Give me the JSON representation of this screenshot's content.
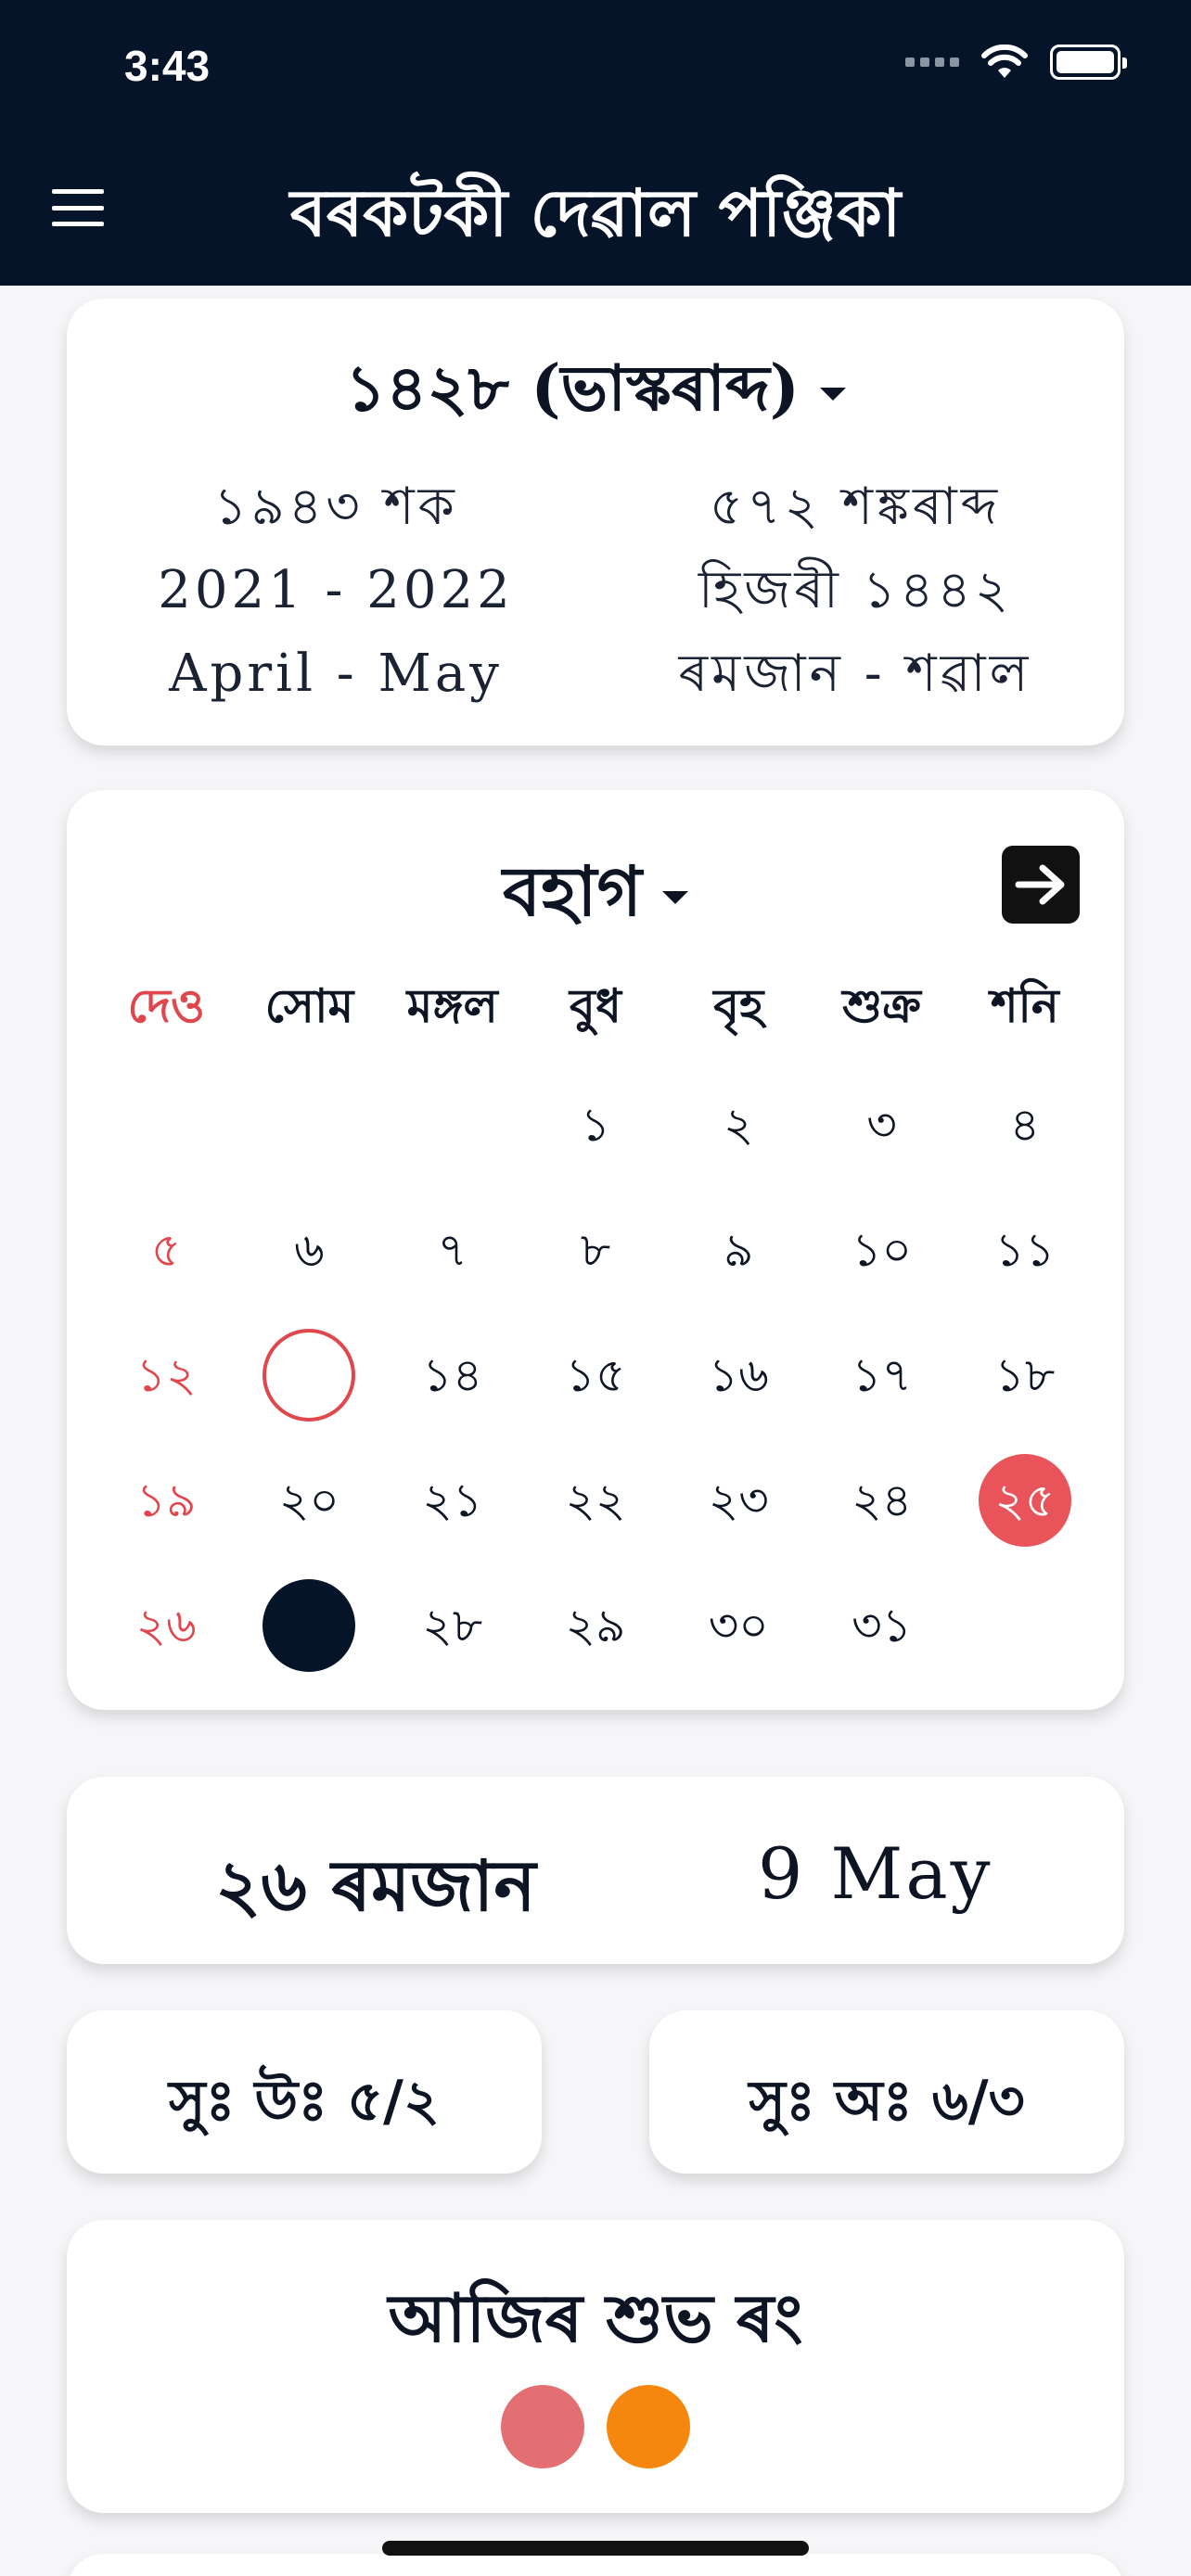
{
  "status": {
    "time": "3:43",
    "signal_icon": "signal-dots-icon",
    "wifi_icon": "wifi-icon",
    "battery_icon": "battery-icon"
  },
  "header": {
    "title": "বৰকটকী দেৱাল পঞ্জিকা",
    "menu_icon": "hamburger-menu-icon"
  },
  "year": {
    "title": "১৪২৮ (ভাস্কৰাব্দ)",
    "left": [
      "১৯৪৩ শক",
      "2021 - 2022",
      "April - May"
    ],
    "right": [
      "৫৭২ শঙ্কৰাব্দ",
      "হিজৰী ১৪৪২",
      "ৰমজান - শৱাল"
    ]
  },
  "calendar": {
    "month": "বহাগ",
    "weekdays": [
      "দেও",
      "সোম",
      "মঙ্গল",
      "বুধ",
      "বৃহ",
      "শুক্র",
      "শনি"
    ],
    "weeks": [
      [
        "",
        "",
        "",
        "১",
        "২",
        "৩",
        "৪"
      ],
      [
        "৫",
        "৬",
        "৭",
        "৮",
        "৯",
        "১০",
        "১১"
      ],
      [
        "১২",
        "",
        "১৪",
        "১৫",
        "১৬",
        "১৭",
        "১৮"
      ],
      [
        "১৯",
        "২০",
        "২১",
        "২২",
        "২৩",
        "২৪",
        "২৫"
      ],
      [
        "২৬",
        "",
        "২৮",
        "২৯",
        "৩০",
        "৩১",
        ""
      ]
    ],
    "colors": {
      "holiday": "#e0474c",
      "selected": "#06142a",
      "highlight": "#e8545a"
    }
  },
  "selected_date": {
    "hijri": "২৬ ৰমজান",
    "gregorian": "9 May"
  },
  "sun": {
    "sunrise": "সুঃ উঃ ৫/২",
    "sunset": "সুঃ অঃ ৬/৩"
  },
  "lucky_color": {
    "title": "আজিৰ শুভ ৰং",
    "colors": [
      "#e36f73",
      "#f5870f"
    ]
  }
}
